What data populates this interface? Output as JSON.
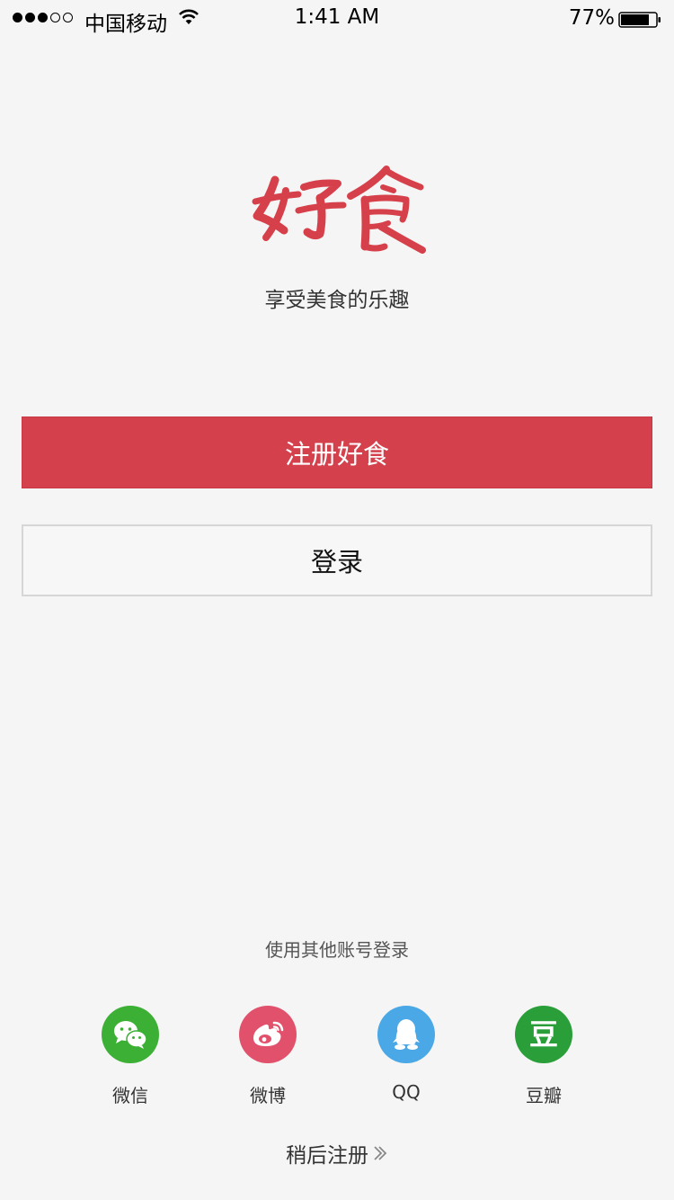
{
  "status_bar": {
    "carrier": "中国移动",
    "time": "1:41 AM",
    "battery": "77%",
    "signal_bars_filled": 3,
    "signal_bars_total": 5,
    "battery_level": 0.77
  },
  "brand": {
    "logo_text": "好食",
    "tagline": "享受美食的乐趣",
    "accent_color": "#d4404c"
  },
  "actions": {
    "register_label": "注册好食",
    "login_label": "登录"
  },
  "other_login": {
    "title": "使用其他账号登录",
    "providers": [
      {
        "label": "微信",
        "icon": "wechat-icon",
        "color": "#3cb034"
      },
      {
        "label": "微博",
        "icon": "weibo-icon",
        "color": "#e2516c"
      },
      {
        "label": "QQ",
        "icon": "qq-icon",
        "color": "#4aa8e6"
      },
      {
        "label": "豆瓣",
        "icon": "douban-icon",
        "color": "#2a9e39",
        "glyph": "豆"
      }
    ]
  },
  "skip": {
    "label": "稍后注册"
  }
}
